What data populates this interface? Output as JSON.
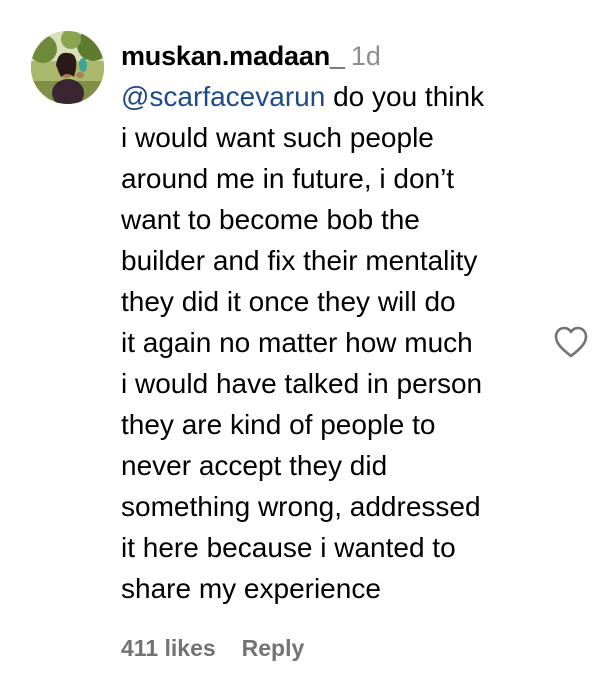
{
  "comment": {
    "username": "muskan.madaan_",
    "time": "1d",
    "mention": "@scarfacevarun",
    "first_line_rest": " do you think",
    "lines": [
      "i would want such people",
      "around me in future, i don’t",
      "want to become bob the",
      "builder and fix their mentality",
      "they did it once they will do",
      "it again no matter how much",
      "i would have talked in person",
      "they are kind of people to",
      "never accept they did",
      "something wrong, addressed",
      "it here because i wanted to",
      "share my experience"
    ],
    "likes": "411 likes",
    "reply_label": "Reply",
    "like_icon": "heart-outline-icon"
  },
  "colors": {
    "text": "#000000",
    "muted": "#737373",
    "timestamp": "#8e8e8e",
    "mention": "#1f4a8a"
  }
}
